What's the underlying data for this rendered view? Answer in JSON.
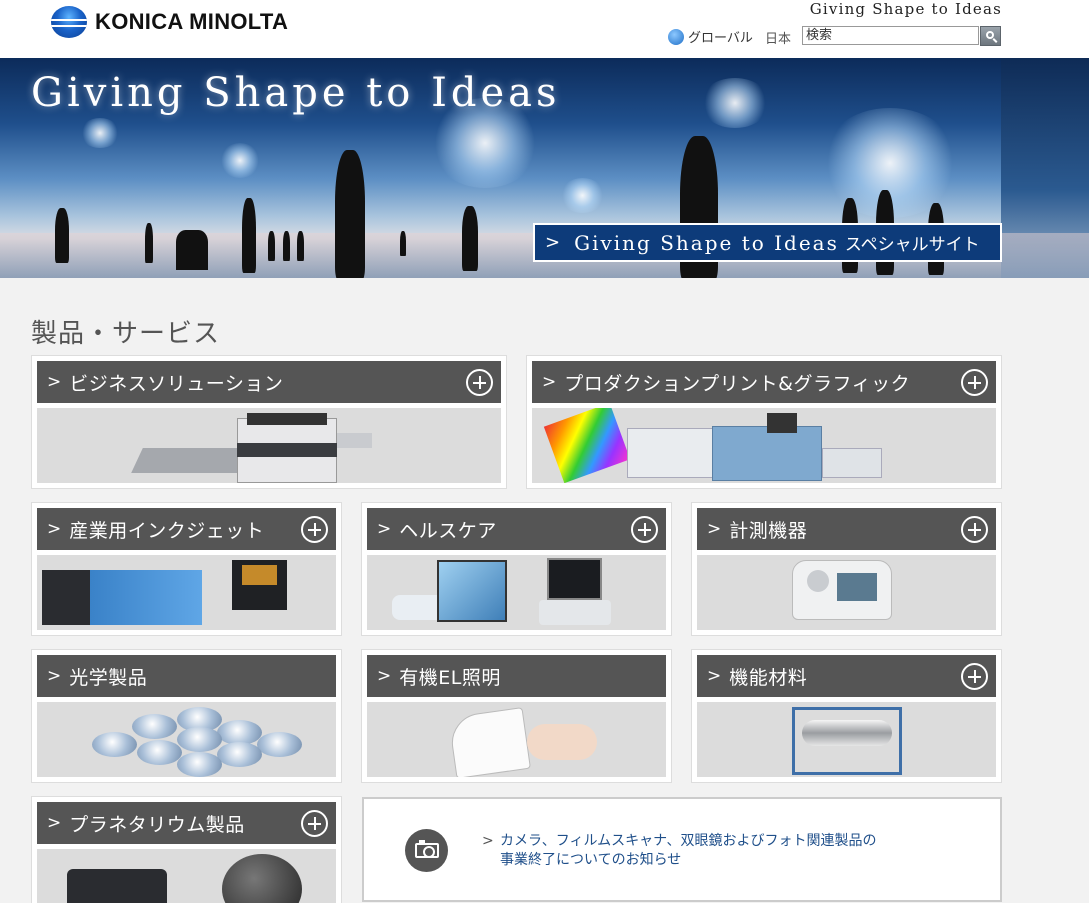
{
  "header": {
    "brand": "KONICA MINOLTA",
    "tagline": "Giving Shape to Ideas",
    "global_label": "グローバル",
    "country_label": "日本",
    "search_placeholder": "検索"
  },
  "hero": {
    "title": "Giving Shape to Ideas",
    "link_en": "Giving Shape to Ideas",
    "link_jp": "スペシャルサイト"
  },
  "section_title": "製品・サービス",
  "cards": [
    {
      "label": "ビジネスソリューション",
      "expandable": true
    },
    {
      "label": "プロダクションプリント&グラフィック",
      "expandable": true
    },
    {
      "label": "産業用インクジェット",
      "expandable": true
    },
    {
      "label": "ヘルスケア",
      "expandable": true
    },
    {
      "label": "計測機器",
      "expandable": true
    },
    {
      "label": "光学製品",
      "expandable": false
    },
    {
      "label": "有機EL照明",
      "expandable": false
    },
    {
      "label": "機能材料",
      "expandable": true
    },
    {
      "label": "プラネタリウム製品",
      "expandable": true
    }
  ],
  "notice": {
    "line1": "カメラ、フィルムスキャナ、双眼鏡およびフォト関連製品の",
    "line2": "事業終了についてのお知らせ",
    "icon": "camera-icon"
  },
  "colors": {
    "card_header": "#555555",
    "hero_link_bg": "#0d3b7a",
    "link_text": "#1f4f8a",
    "page_bg": "#f2f2f2"
  }
}
